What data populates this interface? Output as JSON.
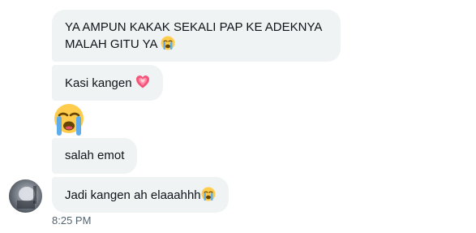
{
  "messages": [
    {
      "line1": "YA AMPUN KAKAK SEKALI PAP KE ADEKNYA",
      "line2": "MALAH GITU YA",
      "emoji": "loudly-crying-face"
    },
    {
      "text": "Kasi kangen",
      "emoji": "growing-heart"
    },
    {
      "emoji": "loudly-crying-face"
    },
    {
      "text": "salah emot"
    },
    {
      "text": "Jadi kangen ah elaaahhh",
      "emoji": "loudly-crying-face"
    }
  ],
  "timestamp": "8:25 PM",
  "colors": {
    "bubble": "#eff3f4",
    "text": "#0f1419",
    "timestamp": "#536471",
    "emoji_face": "#ffcc4d",
    "emoji_tears": "#5dadec",
    "heart": "#f4557a"
  }
}
